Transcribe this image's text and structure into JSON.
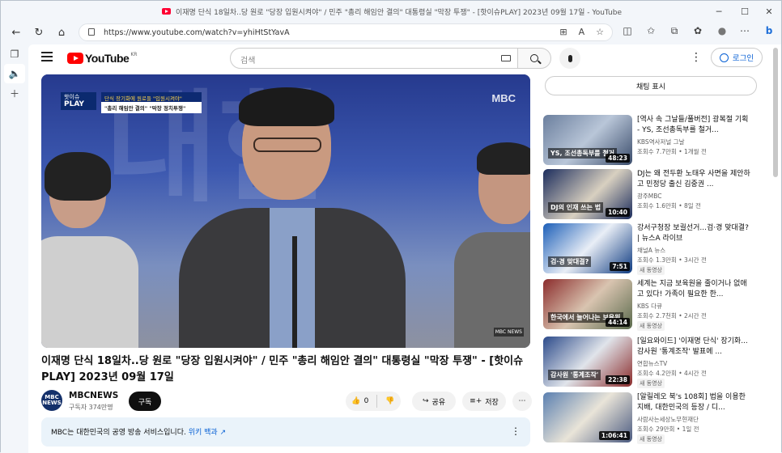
{
  "window": {
    "title": "이재명 단식 18일차..당 원로 \"당장 입원시켜야\" / 민주 \"총리 해임안 결의\" 대통령실 \"막장 투쟁\" - [핫이슈PLAY] 2023년 09월 17일 - YouTube",
    "url": "https://www.youtube.com/watch?v=yhiHtStYavA"
  },
  "header": {
    "logo_text": "YouTube",
    "region": "KR",
    "search_placeholder": "검색",
    "login_label": "로그인"
  },
  "video": {
    "overlay_badge_top": "핫이슈",
    "overlay_badge_bottom": "PLAY",
    "overlay_caption_1": "단식 장기화에 원로들 \"입원시켜야\"",
    "overlay_caption_2": "\"총리 해임안 결의\" \"막장 정치투쟁\"",
    "watermark": "MBC",
    "corner_tag": "MBC NEWS",
    "title": "이재명 단식 18일차..당 원로 \"당장 입원시켜야\" / 민주 \"총리 해임안 결의\" 대통령실 \"막장 투쟁\" - [핫이슈PLAY] 2023년 09월 17일"
  },
  "channel": {
    "avatar_text": "MBC NEWS",
    "name": "MBCNEWS",
    "subscribers": "구독자 374만명",
    "subscribe_label": "구독",
    "likes": "0",
    "share_label": "공유",
    "save_label": "저장"
  },
  "info_bar": {
    "text": "MBC는 대한민국의 공영 방송 서비스입니다.",
    "link": "위키 백과"
  },
  "sidebar": {
    "chat_label": "채팅 표시",
    "recommendations": [
      {
        "title": "[역사 속 그날들/풀버전] 광복절 기획 - YS, 조선총독부를 철거...",
        "channel": "KBS역사저널 그날",
        "meta": "조회수 7.7만회 • 1개월 전",
        "duration": "48:23",
        "badge": "",
        "thumb_caption": "YS, 조선총독부를 철거"
      },
      {
        "title": "DJ는 왜 전두환 노태우 사면을 제안하고 민정당 출신 김중권 ...",
        "channel": "광주MBC",
        "meta": "조회수 1.6만회 • 8일 전",
        "duration": "10:40",
        "badge": "",
        "thumb_caption": "DJ의 인재 쓰는 법"
      },
      {
        "title": "강서구청장 보궐선거...검·경 맞대결? | 뉴스A 라이브",
        "channel": "채널A 뉴스",
        "meta": "조회수 1.3만회 • 3시간 전",
        "duration": "7:51",
        "badge": "새 동영상",
        "thumb_caption": "검·경 맞대결?"
      },
      {
        "title": "세계는 지금 보육원을 줄이거나 없애고 있다! 가족이 필요한 한...",
        "channel": "KBS 다큐",
        "meta": "조회수 2.7천회 • 2시간 전",
        "duration": "44:14",
        "badge": "새 동영상",
        "thumb_caption": "한국에서 늘어나는 보육원"
      },
      {
        "title": "[일요와이드] '이재명 단식' 장기화...감사원 '통계조작' 발표에 ...",
        "channel": "연합뉴스TV",
        "meta": "조회수 4.2만회 • 4시간 전",
        "duration": "22:38",
        "badge": "새 동영상",
        "thumb_caption": "감사원 '통계조작'"
      },
      {
        "title": "[알릴레오 북's 108회] 법을 이용한 지배, 대한민국의 등장 / 디...",
        "channel": "사람사는세상노무현재단",
        "meta": "조회수 29만회 • 1일 전",
        "duration": "1:06:41",
        "badge": "새 동영상",
        "thumb_caption": ""
      }
    ]
  },
  "colors": {
    "accent": "#065fd4",
    "youtube_red": "#ff0000",
    "info_bg": "#eaf3fa"
  }
}
